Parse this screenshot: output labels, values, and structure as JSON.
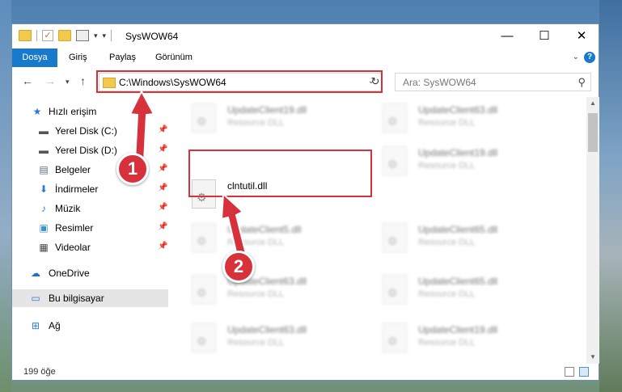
{
  "window": {
    "title": "SysWOW64",
    "controls": {
      "minimize": "—",
      "maximize": "☐",
      "close": "✕"
    }
  },
  "ribbon": {
    "tabs": [
      "Dosya",
      "Giriş",
      "Paylaş",
      "Görünüm"
    ],
    "help": "?"
  },
  "nav": {
    "address": "C:\\Windows\\SysWOW64",
    "search_placeholder": "Ara: SysWOW64"
  },
  "sidebar": {
    "items": [
      {
        "label": "Hızlı erişim",
        "icon": "star-icon",
        "pinned": false
      },
      {
        "label": "Yerel Disk (C:)",
        "icon": "drive-icon",
        "pinned": true
      },
      {
        "label": "Yerel Disk (D:)",
        "icon": "drive-icon",
        "pinned": true
      },
      {
        "label": "Belgeler",
        "icon": "documents-icon",
        "pinned": true
      },
      {
        "label": "İndirmeler",
        "icon": "download-icon",
        "pinned": true
      },
      {
        "label": "Müzik",
        "icon": "music-icon",
        "pinned": true
      },
      {
        "label": "Resimler",
        "icon": "pictures-icon",
        "pinned": true
      },
      {
        "label": "Videolar",
        "icon": "video-icon",
        "pinned": true
      },
      {
        "label": "OneDrive",
        "icon": "cloud-icon",
        "pinned": false
      },
      {
        "label": "Bu bilgisayar",
        "icon": "computer-icon",
        "pinned": false,
        "selected": true
      },
      {
        "label": "Ağ",
        "icon": "network-icon",
        "pinned": false
      }
    ]
  },
  "files": {
    "main": {
      "name": "clntutil.dll"
    },
    "background": [
      {
        "name": "UpdateClient19.dll",
        "type": "Resource DLL"
      },
      {
        "name": "UpdateClient63.dll",
        "type": "Resource DLL"
      },
      {
        "name": "UpdateClient19.dll",
        "type": "Resource DLL"
      },
      {
        "name": "UpdateClient5.dll",
        "type": "Resource DLL"
      },
      {
        "name": "UpdateClient65.dll",
        "type": "Resource DLL"
      },
      {
        "name": "UpdateClient63.dll",
        "type": "Resource DLL"
      },
      {
        "name": "UpdateClient65.dll",
        "type": "Resource DLL"
      },
      {
        "name": "UpdateClient63.dll",
        "type": "Resource DLL"
      },
      {
        "name": "UpdateClient19.dll",
        "type": "Resource DLL"
      }
    ]
  },
  "status": {
    "count": "199 öğe"
  },
  "annotations": {
    "step1": "1",
    "step2": "2"
  },
  "colors": {
    "accent": "#1979ca",
    "highlight": "#d7323b",
    "folder": "#f2c94c"
  }
}
